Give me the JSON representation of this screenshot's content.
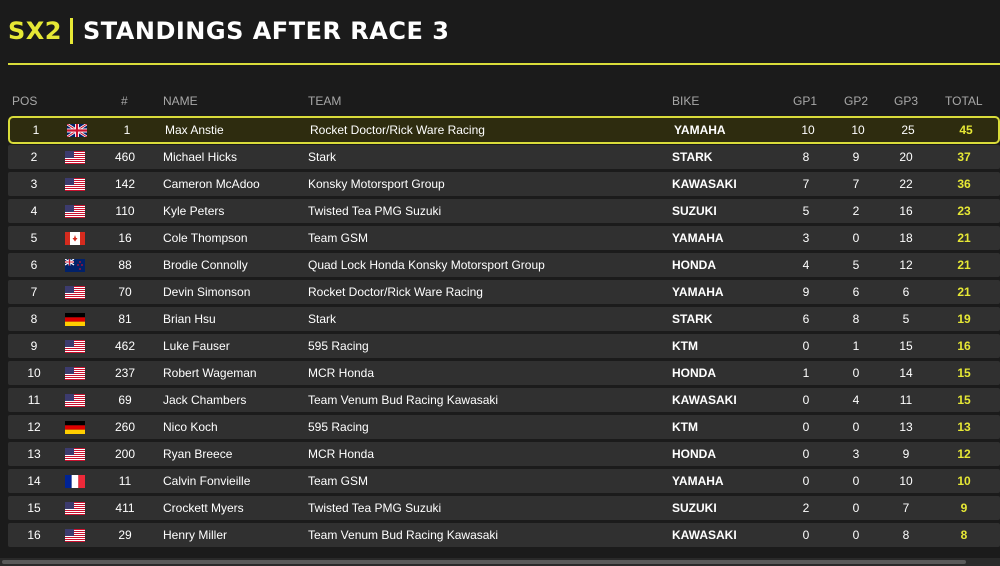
{
  "header": {
    "series": "SX2",
    "title": "STANDINGS AFTER RACE 3"
  },
  "columns": {
    "pos": "POS",
    "num": "#",
    "name": "NAME",
    "team": "TEAM",
    "bike": "BIKE",
    "gp1": "GP1",
    "gp2": "GP2",
    "gp3": "GP3",
    "total": "TOTAL"
  },
  "colors": {
    "accent": "#e6e835",
    "row_bg": "#303030",
    "page_bg": "#1b1b1b"
  },
  "rows": [
    {
      "pos": "1",
      "flag": "gb-flag",
      "num": "1",
      "name": "Max Anstie",
      "team": "Rocket Doctor/Rick Ware Racing",
      "bike": "YAMAHA",
      "gp1": "10",
      "gp2": "10",
      "gp3": "25",
      "total": "45"
    },
    {
      "pos": "2",
      "flag": "us-flag",
      "num": "460",
      "name": "Michael Hicks",
      "team": "Stark",
      "bike": "STARK",
      "gp1": "8",
      "gp2": "9",
      "gp3": "20",
      "total": "37"
    },
    {
      "pos": "3",
      "flag": "us-flag",
      "num": "142",
      "name": "Cameron McAdoo",
      "team": "Konsky Motorsport Group",
      "bike": "KAWASAKI",
      "gp1": "7",
      "gp2": "7",
      "gp3": "22",
      "total": "36"
    },
    {
      "pos": "4",
      "flag": "us-flag",
      "num": "110",
      "name": "Kyle Peters",
      "team": "Twisted Tea PMG Suzuki",
      "bike": "SUZUKI",
      "gp1": "5",
      "gp2": "2",
      "gp3": "16",
      "total": "23"
    },
    {
      "pos": "5",
      "flag": "ca-flag",
      "num": "16",
      "name": "Cole Thompson",
      "team": "Team GSM",
      "bike": "YAMAHA",
      "gp1": "3",
      "gp2": "0",
      "gp3": "18",
      "total": "21"
    },
    {
      "pos": "6",
      "flag": "nz-flag",
      "num": "88",
      "name": "Brodie Connolly",
      "team": "Quad Lock Honda Konsky Motorsport Group",
      "bike": "HONDA",
      "gp1": "4",
      "gp2": "5",
      "gp3": "12",
      "total": "21"
    },
    {
      "pos": "7",
      "flag": "us-flag",
      "num": "70",
      "name": "Devin Simonson",
      "team": "Rocket Doctor/Rick Ware Racing",
      "bike": "YAMAHA",
      "gp1": "9",
      "gp2": "6",
      "gp3": "6",
      "total": "21"
    },
    {
      "pos": "8",
      "flag": "de-flag",
      "num": "81",
      "name": "Brian Hsu",
      "team": "Stark",
      "bike": "STARK",
      "gp1": "6",
      "gp2": "8",
      "gp3": "5",
      "total": "19"
    },
    {
      "pos": "9",
      "flag": "us-flag",
      "num": "462",
      "name": "Luke Fauser",
      "team": "595 Racing",
      "bike": "KTM",
      "gp1": "0",
      "gp2": "1",
      "gp3": "15",
      "total": "16"
    },
    {
      "pos": "10",
      "flag": "us-flag",
      "num": "237",
      "name": "Robert Wageman",
      "team": "MCR Honda",
      "bike": "HONDA",
      "gp1": "1",
      "gp2": "0",
      "gp3": "14",
      "total": "15"
    },
    {
      "pos": "11",
      "flag": "us-flag",
      "num": "69",
      "name": "Jack Chambers",
      "team": "Team Venum Bud Racing Kawasaki",
      "bike": "KAWASAKI",
      "gp1": "0",
      "gp2": "4",
      "gp3": "11",
      "total": "15"
    },
    {
      "pos": "12",
      "flag": "de-flag",
      "num": "260",
      "name": "Nico Koch",
      "team": "595 Racing",
      "bike": "KTM",
      "gp1": "0",
      "gp2": "0",
      "gp3": "13",
      "total": "13"
    },
    {
      "pos": "13",
      "flag": "us-flag",
      "num": "200",
      "name": "Ryan Breece",
      "team": "MCR Honda",
      "bike": "HONDA",
      "gp1": "0",
      "gp2": "3",
      "gp3": "9",
      "total": "12"
    },
    {
      "pos": "14",
      "flag": "fr-flag",
      "num": "11",
      "name": "Calvin Fonvieille",
      "team": "Team GSM",
      "bike": "YAMAHA",
      "gp1": "0",
      "gp2": "0",
      "gp3": "10",
      "total": "10"
    },
    {
      "pos": "15",
      "flag": "us-flag",
      "num": "411",
      "name": "Crockett Myers",
      "team": "Twisted Tea PMG Suzuki",
      "bike": "SUZUKI",
      "gp1": "2",
      "gp2": "0",
      "gp3": "7",
      "total": "9"
    },
    {
      "pos": "16",
      "flag": "us-flag",
      "num": "29",
      "name": "Henry Miller",
      "team": "Team Venum Bud Racing Kawasaki",
      "bike": "KAWASAKI",
      "gp1": "0",
      "gp2": "0",
      "gp3": "8",
      "total": "8"
    }
  ]
}
